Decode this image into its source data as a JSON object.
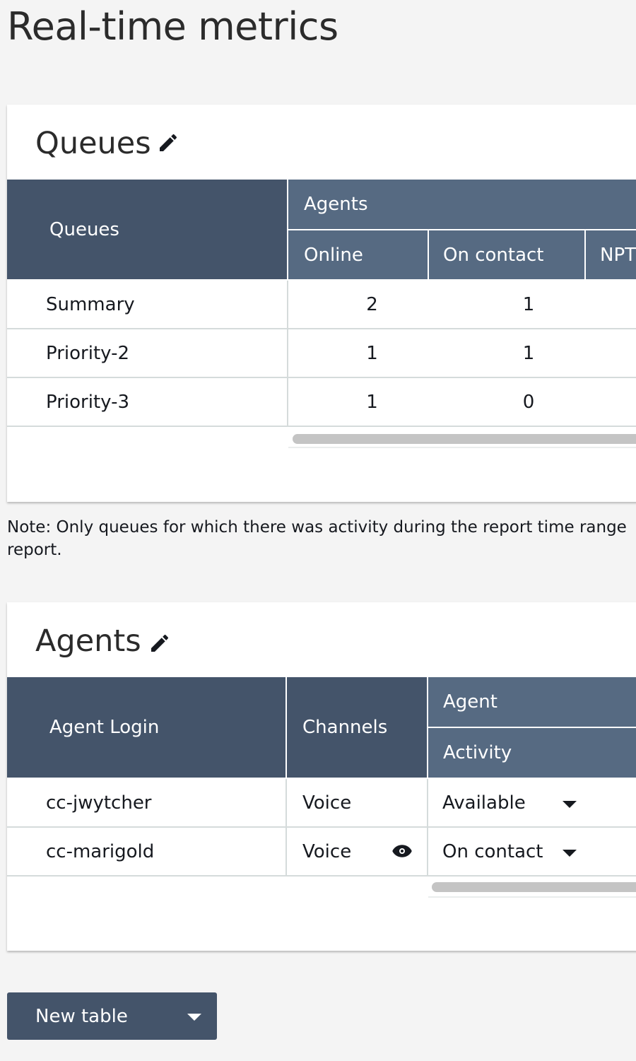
{
  "page": {
    "title": "Real-time metrics"
  },
  "queues_table": {
    "title": "Queues",
    "header": {
      "queues": "Queues",
      "group_agents": "Agents",
      "online": "Online",
      "on_contact": "On contact",
      "npt": "NPT"
    },
    "rows": [
      {
        "name": "Summary",
        "online": "2",
        "on_contact": "1"
      },
      {
        "name": "Priority-2",
        "online": "1",
        "on_contact": "1"
      },
      {
        "name": "Priority-3",
        "online": "1",
        "on_contact": "0"
      }
    ]
  },
  "note": "Note: Only queues for which there was activity during the report time range report.",
  "agents_table": {
    "title": "Agents",
    "header": {
      "agent_login": "Agent Login",
      "channels": "Channels",
      "group_agent": "Agent",
      "activity": "Activity"
    },
    "rows": [
      {
        "login": "cc-jwytcher",
        "channel": "Voice",
        "activity": "Available"
      },
      {
        "login": "cc-marigold",
        "channel": "Voice",
        "activity": "On contact"
      }
    ]
  },
  "footer": {
    "new_table_label": "New table"
  },
  "icons": {
    "edit": "pencil-icon",
    "monitor": "eye-icon",
    "dropdown": "caret-down-icon"
  },
  "colors": {
    "header_dark": "#44546a",
    "header_light": "#566a82",
    "button": "#44546a"
  }
}
